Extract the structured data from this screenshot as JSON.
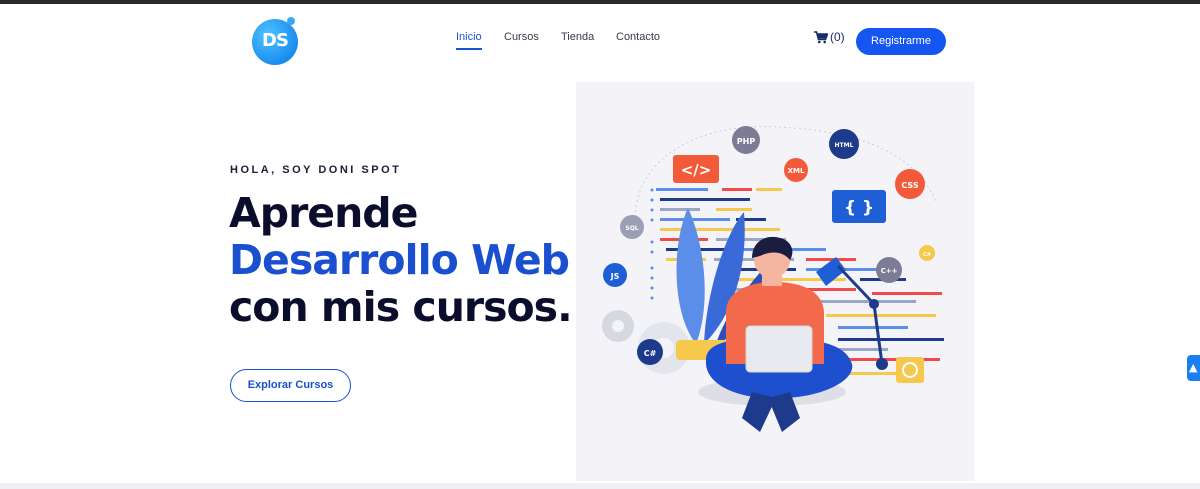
{
  "header": {
    "logo_text": "DS",
    "nav": [
      {
        "label": "Inicio",
        "active": true
      },
      {
        "label": "Cursos",
        "active": false
      },
      {
        "label": "Tienda",
        "active": false
      },
      {
        "label": "Contacto",
        "active": false
      }
    ],
    "cart_count": "(0)",
    "register_label": "Registrarme"
  },
  "hero": {
    "eyebrow": "HOLA, SOY DONI SPOT",
    "title_line1": "Aprende",
    "title_line2": "Desarrollo Web",
    "title_line3": "con mis cursos.",
    "cta_label": "Explorar Cursos"
  },
  "illustration": {
    "badges": {
      "php": "PHP",
      "html": "HTML",
      "xml": "XML",
      "css": "CSS",
      "sql": "SQL",
      "js": "JS",
      "cpp": "C++",
      "csharp": "C#",
      "cs_small": "C#",
      "code_tag": "</>",
      "braces": "{ }"
    }
  },
  "colors": {
    "accent": "#1656f0",
    "title_blue": "#1a4fcf",
    "dark": "#0b0d2c",
    "css_badge": "#f25a3a",
    "shirt": "#f26a4b"
  },
  "icons": {
    "cart": "shopping-cart-icon",
    "scroll_tab": "accessibility-icon"
  }
}
